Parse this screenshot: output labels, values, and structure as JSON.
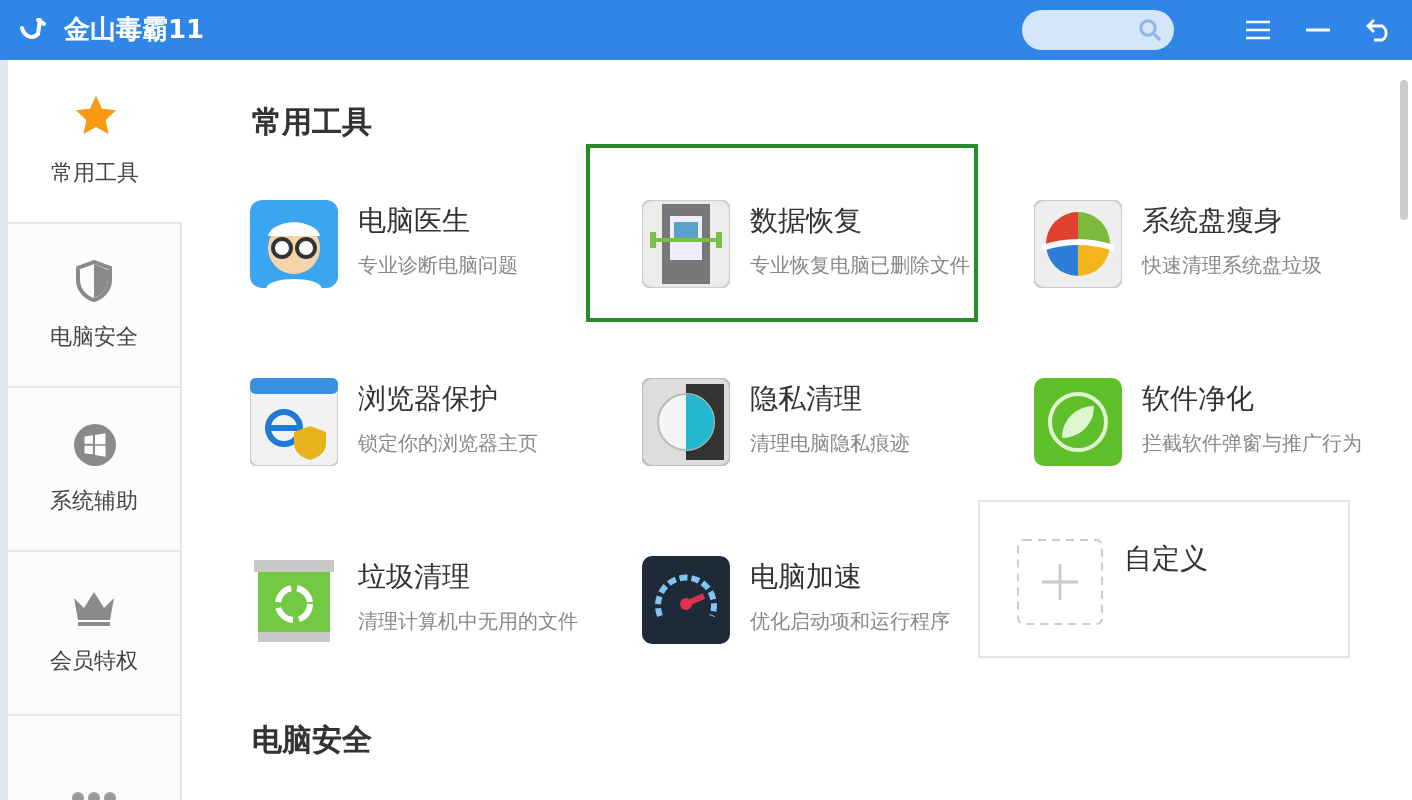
{
  "window": {
    "title": "金山毒霸11"
  },
  "sidebar": {
    "items": [
      {
        "label": "常用工具",
        "selected": true
      },
      {
        "label": "电脑安全",
        "selected": false
      },
      {
        "label": "系统辅助",
        "selected": false
      },
      {
        "label": "会员特权",
        "selected": false
      },
      {
        "selected": false
      }
    ]
  },
  "sections": [
    {
      "title": "常用工具",
      "tools": [
        {
          "kind": "tool",
          "name": "电脑医生",
          "desc": "专业诊断电脑问题",
          "selected": false
        },
        {
          "kind": "tool",
          "name": "数据恢复",
          "desc": "专业恢复电脑已删除文件",
          "selected": true
        },
        {
          "kind": "tool",
          "name": "系统盘瘦身",
          "desc": "快速清理系统盘垃圾",
          "selected": false
        },
        {
          "kind": "tool",
          "name": "浏览器保护",
          "desc": "锁定你的浏览器主页",
          "selected": false
        },
        {
          "kind": "tool",
          "name": "隐私清理",
          "desc": "清理电脑隐私痕迹",
          "selected": false
        },
        {
          "kind": "tool",
          "name": "软件净化",
          "desc": "拦截软件弹窗与推广行为",
          "selected": false
        },
        {
          "kind": "tool",
          "name": "垃圾清理",
          "desc": "清理计算机中无用的文件",
          "selected": false
        },
        {
          "kind": "tool",
          "name": "电脑加速",
          "desc": "优化启动项和运行程序",
          "selected": false
        },
        {
          "kind": "custom",
          "name": "自定义",
          "selected": false
        }
      ]
    },
    {
      "title": "电脑安全"
    }
  ]
}
